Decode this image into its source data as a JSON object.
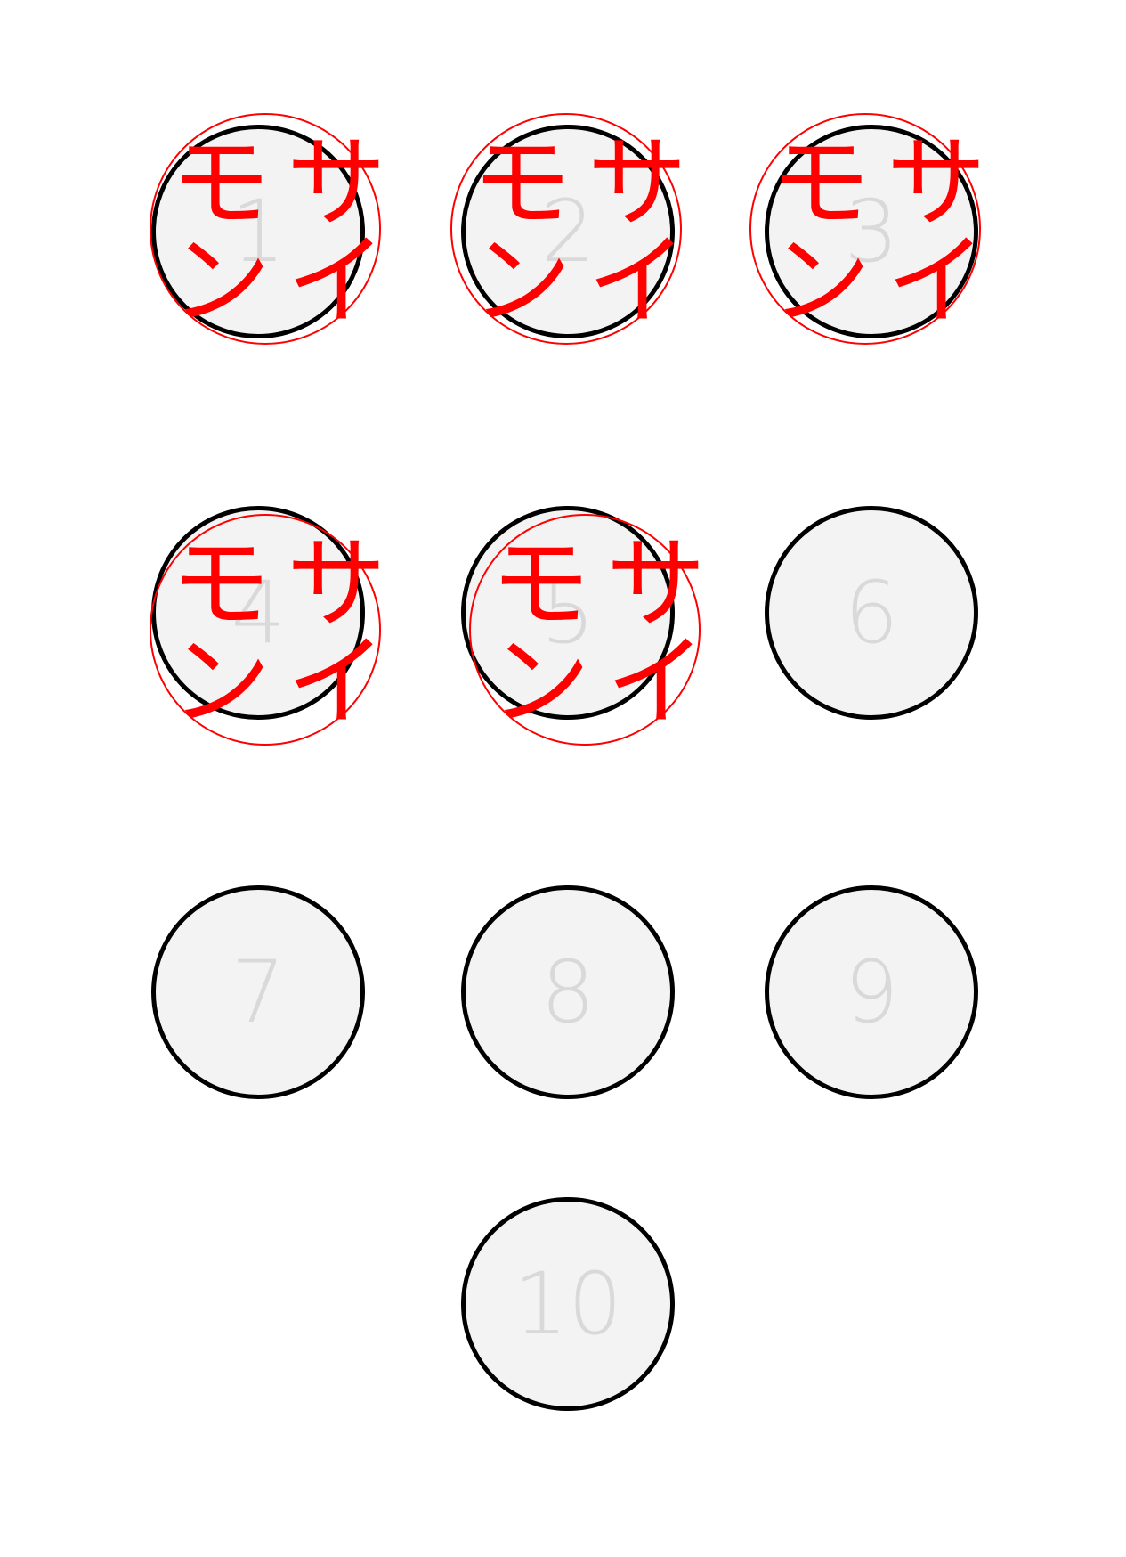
{
  "pins": [
    {
      "label": "1",
      "knocked": true
    },
    {
      "label": "2",
      "knocked": true
    },
    {
      "label": "3",
      "knocked": true
    },
    {
      "label": "4",
      "knocked": true
    },
    {
      "label": "5",
      "knocked": true
    },
    {
      "label": "6",
      "knocked": false
    },
    {
      "label": "7",
      "knocked": false
    },
    {
      "label": "8",
      "knocked": false
    },
    {
      "label": "9",
      "knocked": false
    },
    {
      "label": "10",
      "knocked": false
    }
  ],
  "mark_text": [
    "モ",
    "サ",
    "ン",
    "イ"
  ],
  "colors": {
    "pin_fill": "#f3f3f3",
    "pin_border": "#000000",
    "pin_label": "#d9d9d9",
    "mark": "#ff0000"
  }
}
